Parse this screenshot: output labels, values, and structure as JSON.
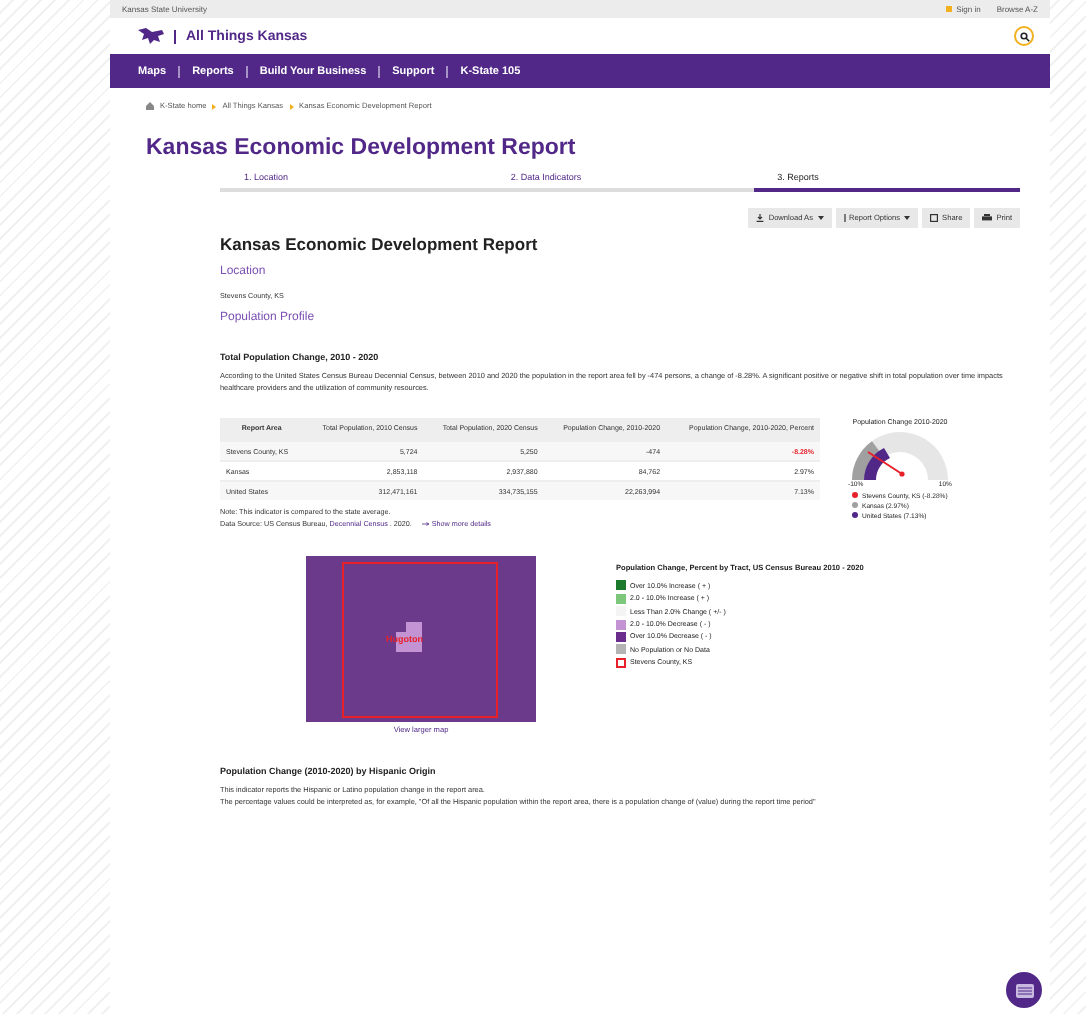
{
  "top_bar": {
    "university": "Kansas State University",
    "links": [
      "Sign in",
      "Browse A-Z"
    ]
  },
  "header": {
    "site_title": "All Things Kansas"
  },
  "nav": [
    "Maps",
    "Reports",
    "Build Your Business",
    "Support",
    "K-State 105"
  ],
  "breadcrumb": [
    "K-State home",
    "All Things Kansas",
    "Kansas Economic Development Report"
  ],
  "page_title": "Kansas Economic Development Report",
  "steps": [
    {
      "label": "1. Location",
      "selected": false
    },
    {
      "label": "2. Data Indicators",
      "selected": false
    },
    {
      "label": "3. Reports",
      "selected": true
    }
  ],
  "toolbar": [
    {
      "label": "Download As",
      "kind": "download",
      "dropdown": true
    },
    {
      "label": "Report Options",
      "kind": "options",
      "dropdown": true
    },
    {
      "label": "Share",
      "kind": "share",
      "dropdown": false
    },
    {
      "label": "Print",
      "kind": "print",
      "dropdown": false
    }
  ],
  "report": {
    "title": "Kansas Economic Development Report",
    "location_heading": "Location",
    "location": "Stevens County, KS",
    "profile_heading": "Population Profile"
  },
  "section1": {
    "title": "Total Population Change, 2010 - 2020",
    "text": "According to the United States Census Bureau Decennial Census, between 2010 and 2020 the population in the report area fell by -474 persons, a change of -8.28%. A significant positive or negative shift in total population over time impacts healthcare providers and the utilization of community resources.",
    "table": {
      "columns": [
        "Report Area",
        "Total Population, 2010 Census",
        "Total Population, 2020 Census",
        "Population Change, 2010-2020",
        "Population Change, 2010-2020, Percent"
      ],
      "rows": [
        {
          "cells": [
            "Stevens County, KS",
            "5,724",
            "5,250",
            "-474",
            "-8.28%"
          ],
          "highlight": true
        },
        {
          "cells": [
            "Kansas",
            "2,853,118",
            "2,937,880",
            "84,762",
            "2.97%"
          ],
          "highlight": false
        },
        {
          "cells": [
            "United States",
            "312,471,161",
            "334,735,155",
            "22,263,994",
            "7.13%"
          ],
          "highlight": false
        }
      ]
    },
    "note": "Note: This indicator is compared to the state average.",
    "source": "Data Source: US Census Bureau,",
    "source_link": "Decennial Census",
    "source_year": ". 2020.",
    "details_link": "Show more details",
    "gauge": {
      "title": "Population Change 2010-2020",
      "min_label": "-10%",
      "max_label": "10%",
      "legend": [
        {
          "label": "Stevens County, KS (-8.28%)",
          "color": "#e8202a"
        },
        {
          "label": "Kansas (2.97%)",
          "color": "#a0a0a0"
        },
        {
          "label": "United States (7.13%)",
          "color": "#512888"
        }
      ]
    }
  },
  "map": {
    "place_label": "Hugoton",
    "link": "View larger map",
    "legend_title": "Population Change, Percent by Tract, US Census Bureau 2010 - 2020",
    "legend": [
      {
        "label": "Over 10.0% Increase ( + )",
        "color": "#1b7a2c",
        "kind": "fill"
      },
      {
        "label": "2.0 - 10.0% Increase ( + )",
        "color": "#7cc77a",
        "kind": "fill"
      },
      {
        "label": "Less Than 2.0% Change ( +/- )",
        "color": "#f4f4f4",
        "kind": "fill"
      },
      {
        "label": "2.0 - 10.0% Decrease ( - )",
        "color": "#c393d3",
        "kind": "fill"
      },
      {
        "label": "Over 10.0% Decrease ( - )",
        "color": "#6b2d8c",
        "kind": "fill"
      },
      {
        "label": "No Population or No Data",
        "color": "#b4b4b4",
        "kind": "fill"
      },
      {
        "label": "Stevens County, KS",
        "color": "#e8202a",
        "kind": "outline"
      }
    ]
  },
  "section2": {
    "title": "Population Change (2010-2020) by Hispanic Origin",
    "lines": [
      "This indicator reports the Hispanic or Latino population change in the report area.",
      "The percentage values could be interpreted as, for example, \"Of all the Hispanic population within the report area, there is a population change of (value) during the report time period\""
    ]
  }
}
